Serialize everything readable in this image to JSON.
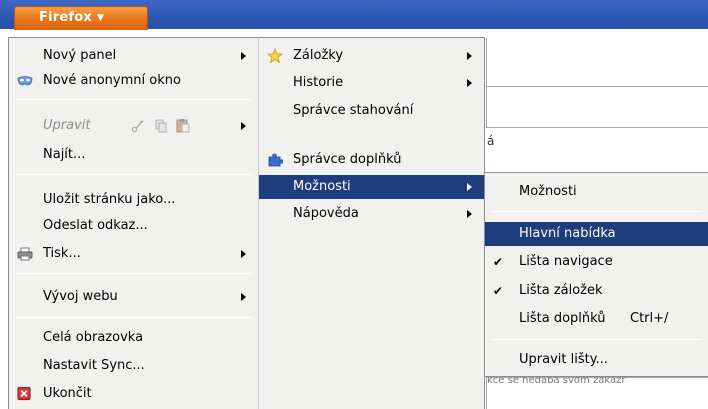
{
  "app_button": {
    "label": "Firefox"
  },
  "background": {
    "fragment_1": "á",
    "fragment_2": "kce se nedaba svom zákazr"
  },
  "main_menu": [
    {
      "label": "Nový panel",
      "has_submenu": true
    },
    {
      "label": "Nové anonymní okno",
      "icon": "mask-icon"
    },
    {
      "label": "Upravit",
      "disabled": true,
      "has_submenu": true,
      "icons": [
        "cut-icon",
        "copy-icon",
        "paste-icon"
      ]
    },
    {
      "label": "Najít..."
    },
    {
      "label": "Uložit stránku jako..."
    },
    {
      "label": "Odeslat odkaz..."
    },
    {
      "label": "Tisk...",
      "icon": "printer-icon",
      "has_submenu": true
    },
    {
      "label": "Vývoj webu",
      "has_submenu": true
    },
    {
      "label": "Celá obrazovka"
    },
    {
      "label": "Nastavit Sync..."
    },
    {
      "label": "Ukončit",
      "icon": "exit-icon"
    }
  ],
  "submenu_1": [
    {
      "label": "Záložky",
      "icon": "star-icon",
      "has_submenu": true
    },
    {
      "label": "Historie",
      "has_submenu": true
    },
    {
      "label": "Správce stahování"
    },
    {
      "label": "Správce doplňků",
      "icon": "puzzle-icon"
    },
    {
      "label": "Možnosti",
      "has_submenu": true,
      "active": true
    },
    {
      "label": "Nápověda",
      "has_submenu": true
    }
  ],
  "submenu_2": [
    {
      "label": "Možnosti"
    },
    {
      "label": "Hlavní nabídka",
      "active": true
    },
    {
      "label": "Lišta navigace",
      "checked": true
    },
    {
      "label": "Lišta záložek",
      "checked": true
    },
    {
      "label": "Lišta doplňků",
      "shortcut": "Ctrl+/"
    },
    {
      "label": "Upravit lišty..."
    }
  ],
  "colors": {
    "highlight": "#1d3d7e",
    "menu_bg": "#f1f1ef",
    "firefox_orange": "#e8741a",
    "title_blue": "#2c56b4"
  }
}
